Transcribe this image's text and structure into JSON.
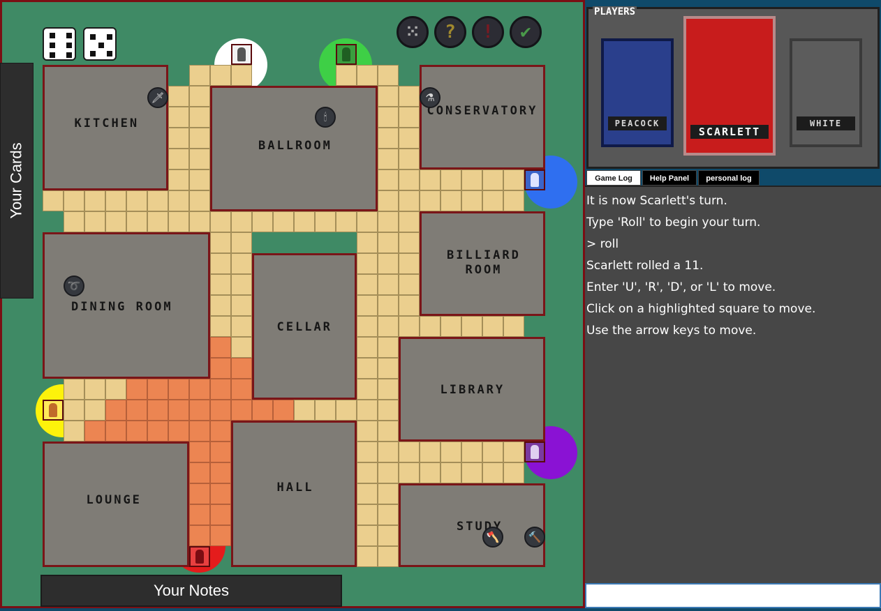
{
  "board": {
    "rooms": [
      {
        "id": "kitchen",
        "label": "KITCHEN"
      },
      {
        "id": "ballroom",
        "label": "BALLROOM"
      },
      {
        "id": "conservatory",
        "label": "CONSERVATORY"
      },
      {
        "id": "dining",
        "label": "DINING ROOM"
      },
      {
        "id": "cellar",
        "label": "CELLAR"
      },
      {
        "id": "billiard",
        "label": "BILLIARD\nROOM"
      },
      {
        "id": "library",
        "label": "LIBRARY"
      },
      {
        "id": "lounge",
        "label": "LOUNGE"
      },
      {
        "id": "hall",
        "label": "HALL"
      },
      {
        "id": "study",
        "label": "STUDY"
      }
    ],
    "dice": [
      6,
      5
    ],
    "controls": [
      {
        "name": "dice-button",
        "glyph": "⁙",
        "color": "#aaaaaa"
      },
      {
        "name": "help-button",
        "glyph": "?",
        "color": "#a0882e"
      },
      {
        "name": "alert-button",
        "glyph": "!",
        "color": "#7a1a22"
      },
      {
        "name": "confirm-button",
        "glyph": "✔",
        "color": "#4a9a4a"
      }
    ],
    "start_colors": {
      "white": "#ffffff",
      "green": "#3ecf46",
      "blue": "#2f6ff0",
      "yellow": "#fdf20b",
      "purple": "#8a12d4",
      "red": "#e41c1c"
    },
    "weapons": [
      {
        "name": "knife-icon",
        "glyph": "🗡"
      },
      {
        "name": "candlestick-icon",
        "glyph": "🕯"
      },
      {
        "name": "poison-bottle-icon",
        "glyph": "⚗"
      },
      {
        "name": "rope-icon",
        "glyph": "➰"
      },
      {
        "name": "axe-icon",
        "glyph": "🪓"
      },
      {
        "name": "hammer-icon",
        "glyph": "🔨"
      }
    ]
  },
  "tabs": {
    "your_cards": "Your Cards",
    "your_notes": "Your Notes"
  },
  "players": {
    "title": "PLAYERS",
    "list": [
      {
        "name": "PEACOCK",
        "bg": "#2a3f8c",
        "fig": "#5a87c6",
        "frame": "#0f1a48"
      },
      {
        "name": "SCARLETT",
        "bg": "#c81c1c",
        "fig": "#e15a5a",
        "frame": "#b78a8a"
      },
      {
        "name": "WHITE",
        "bg": "#5c5c5c",
        "fig": "#d0d0d0",
        "frame": "#3a3a3a"
      }
    ]
  },
  "log_tabs": [
    "Game Log",
    "Help Panel",
    "personal log"
  ],
  "log": [
    "It is now Scarlett's turn.",
    "Type 'Roll' to begin your turn.",
    "> roll",
    "Scarlett rolled a 11.",
    "Enter 'U', 'R', 'D', or 'L' to move.",
    "Click on a highlighted square to move.",
    "Use the arrow keys to move."
  ],
  "command_input": {
    "value": "",
    "placeholder": ""
  }
}
